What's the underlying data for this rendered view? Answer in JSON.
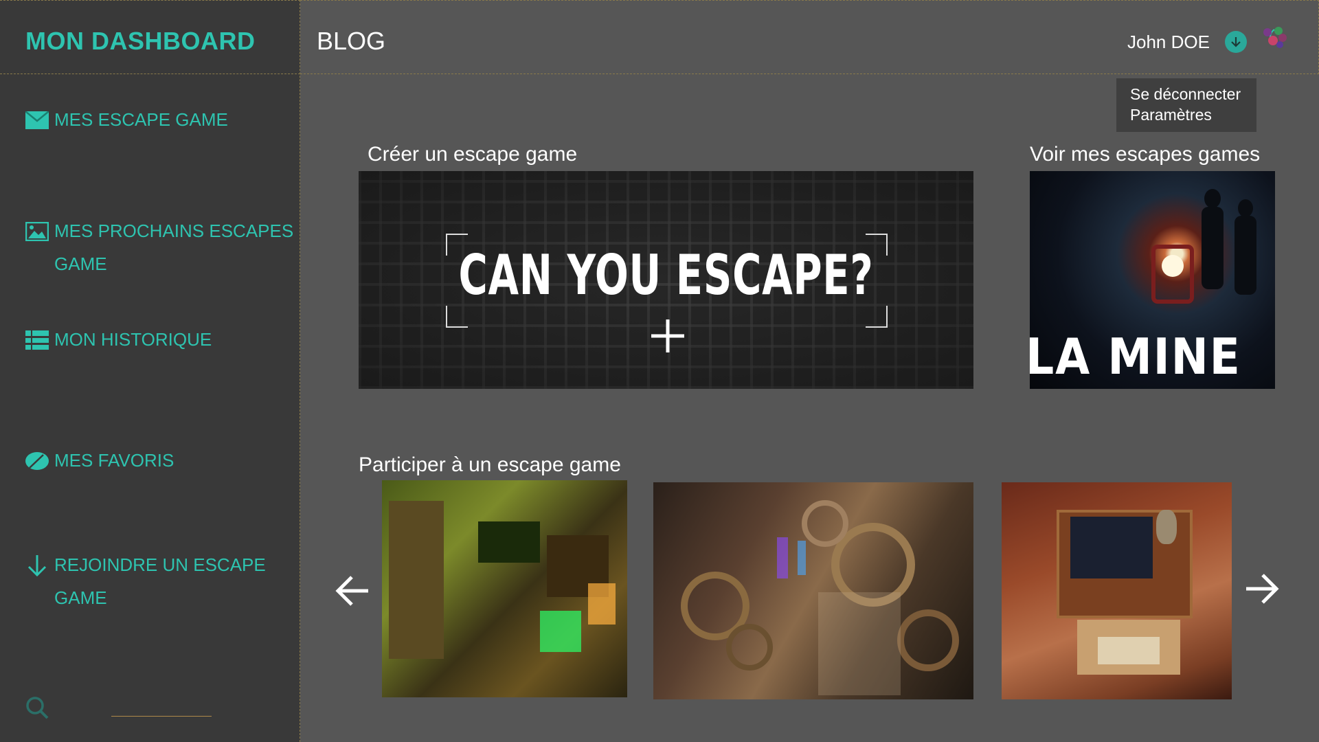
{
  "sidebar": {
    "brand": "MON DASHBOARD",
    "items": [
      {
        "label": "MES ESCAPE GAME",
        "icon": "envelope-icon"
      },
      {
        "label": "MES PROCHAINS ESCAPES GAME",
        "icon": "image-icon"
      },
      {
        "label": "MON HISTORIQUE",
        "icon": "list-icon"
      },
      {
        "label": "MES FAVORIS",
        "icon": "leaf-icon"
      },
      {
        "label": "REJOINDRE UN ESCAPE GAME",
        "icon": "arrow-down-icon"
      }
    ],
    "search_icon": "search-icon"
  },
  "header": {
    "title": "BLOG",
    "username": "John DOE",
    "user_menu_icon": "chevron-down-circle-icon",
    "avatar_icon": "avatar-icon"
  },
  "user_menu": {
    "logout": "Se déconnecter",
    "settings": "Paramètres"
  },
  "sections": {
    "create": {
      "title": "Créer un escape game",
      "banner_text": "CAN YOU ESCAPE?"
    },
    "mine": {
      "title": "Voir mes escapes games",
      "card_text": "LA MINE"
    },
    "join": {
      "title": "Participer à un escape game"
    }
  },
  "colors": {
    "accent": "#2ec4b0",
    "sidebar_bg": "#393939",
    "page_bg": "#565656",
    "lock_red": "#d8232a"
  }
}
